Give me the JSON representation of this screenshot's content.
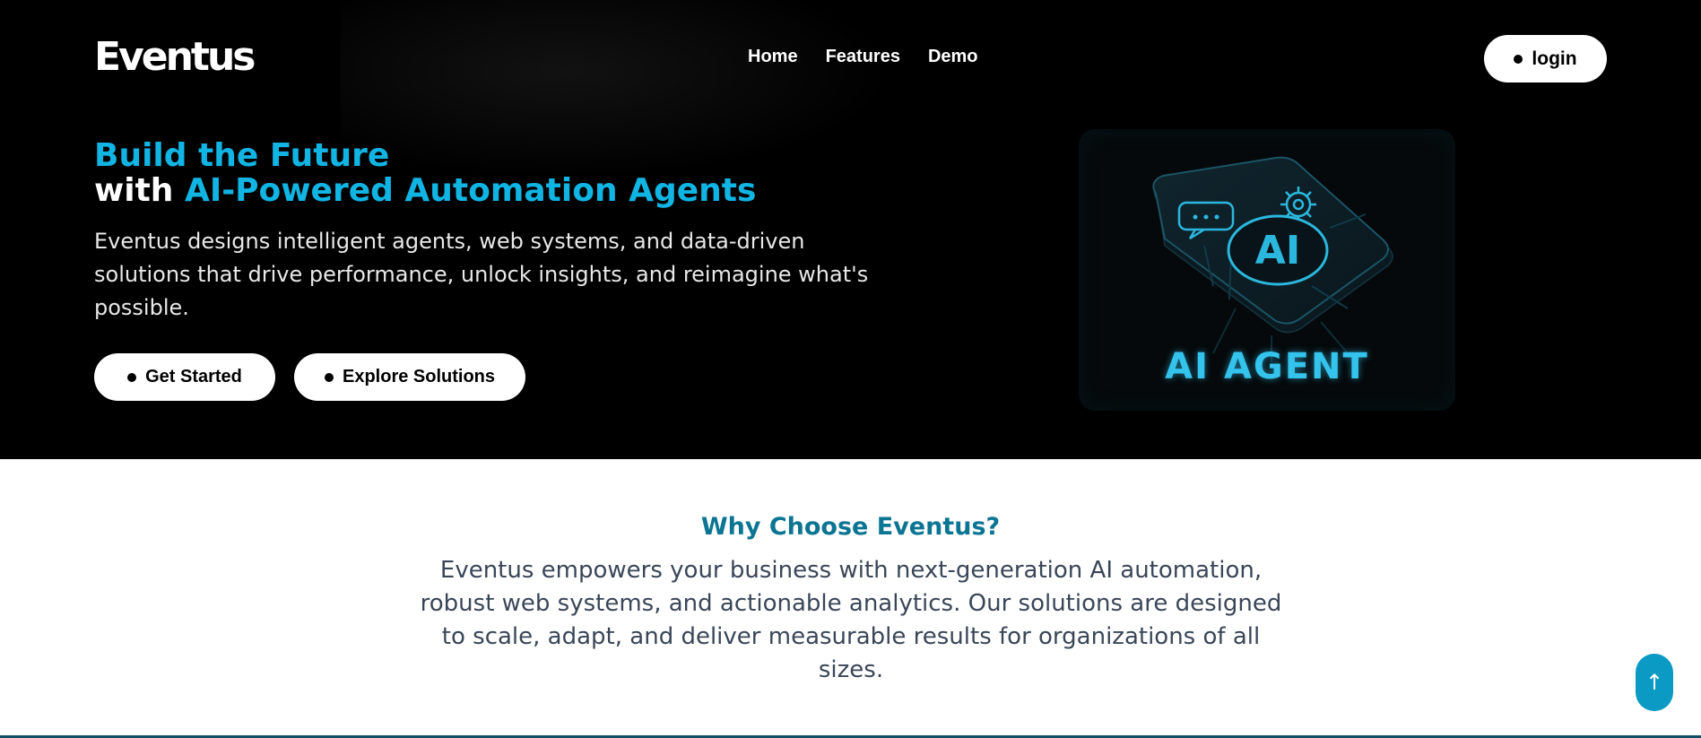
{
  "header": {
    "logo": "Eventus",
    "nav": [
      "Home",
      "Features",
      "Demo"
    ],
    "login_label": "login"
  },
  "hero": {
    "title_line1": "Build the Future",
    "title_line2_prefix": "with ",
    "title_line2_highlight": "AI-Powered Automation Agents",
    "description": "Eventus designs intelligent agents, web systems, and data-driven solutions that drive performance, unlock insights, and reimagine what's possible.",
    "primary_button": "Get Started",
    "secondary_button": "Explore Solutions",
    "image_label": "AI AGENT",
    "image_badge": "AI"
  },
  "why": {
    "title": "Why Choose Eventus?",
    "description": "Eventus empowers your business with next-generation AI automation, robust web systems, and actionable analytics. Our solutions are designed to scale, adapt, and deliver measurable results for organizations of all sizes."
  },
  "scroll_top": {
    "icon": "arrow-up-icon",
    "glyph": "↑"
  },
  "colors": {
    "accent": "#11b5e4",
    "section_title": "#0c7593",
    "scroll_button": "#0a9ac4",
    "hero_bg": "#000000"
  }
}
